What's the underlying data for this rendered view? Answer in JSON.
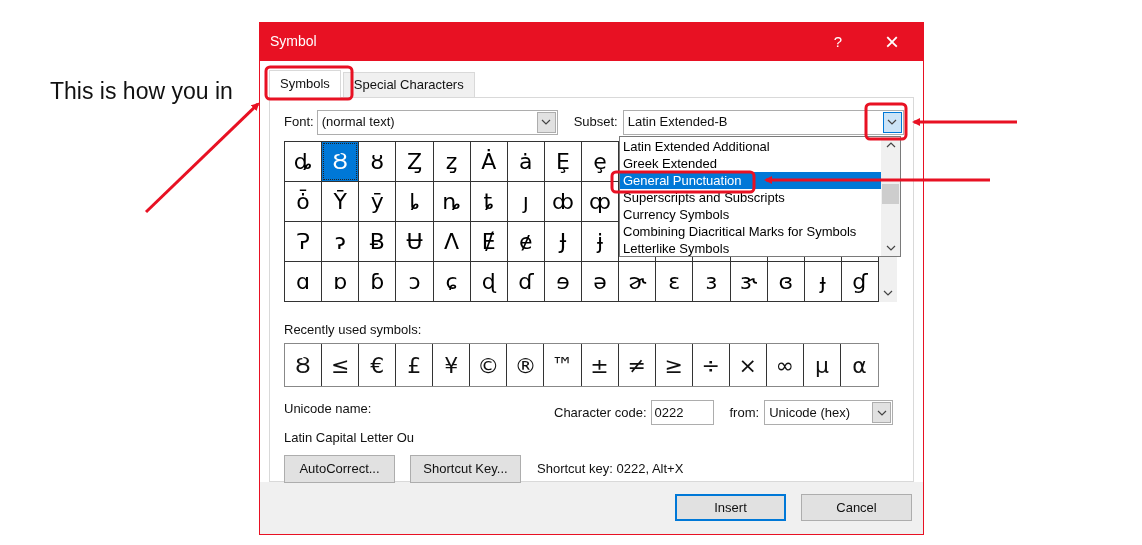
{
  "document": {
    "text": "This is how you in"
  },
  "window": {
    "title": "Symbol",
    "help": "?",
    "close": "×"
  },
  "tabs": [
    {
      "label": "Symbols",
      "selected": true
    },
    {
      "label": "Special Characters",
      "selected": false
    }
  ],
  "font": {
    "label": "Font:",
    "value": "(normal text)"
  },
  "subset": {
    "label": "Subset:",
    "value": "Latin Extended-B",
    "expanded": true,
    "options": [
      {
        "label": "Latin Extended Additional",
        "selected": false
      },
      {
        "label": "Greek Extended",
        "selected": false
      },
      {
        "label": "General Punctuation",
        "selected": true
      },
      {
        "label": "Superscripts and Subscripts",
        "selected": false
      },
      {
        "label": "Currency Symbols",
        "selected": false
      },
      {
        "label": "Combining Diacritical Marks for Symbols",
        "selected": false
      },
      {
        "label": "Letterlike Symbols",
        "selected": false
      }
    ]
  },
  "symbol_grid": [
    [
      {
        "symbol": "ȡ",
        "selected": false
      },
      {
        "symbol": "Ȣ",
        "selected": true
      },
      {
        "symbol": "ȣ",
        "selected": false
      },
      {
        "symbol": "Ȥ",
        "selected": false
      },
      {
        "symbol": "ȥ",
        "selected": false
      },
      {
        "symbol": "Ȧ",
        "selected": false
      },
      {
        "symbol": "ȧ",
        "selected": false
      },
      {
        "symbol": "Ȩ",
        "selected": false
      },
      {
        "symbol": "ȩ",
        "selected": false
      }
    ],
    [
      {
        "symbol": "ȱ",
        "selected": false
      },
      {
        "symbol": "Ȳ",
        "selected": false
      },
      {
        "symbol": "ȳ",
        "selected": false
      },
      {
        "symbol": "ȴ",
        "selected": false
      },
      {
        "symbol": "ȵ",
        "selected": false
      },
      {
        "symbol": "ȶ",
        "selected": false
      },
      {
        "symbol": "ȷ",
        "selected": false
      },
      {
        "symbol": "ȸ",
        "selected": false
      },
      {
        "symbol": "ȹ",
        "selected": false
      }
    ],
    [
      {
        "symbol": "Ɂ",
        "selected": false
      },
      {
        "symbol": "ɂ",
        "selected": false
      },
      {
        "symbol": "Ƀ",
        "selected": false
      },
      {
        "symbol": "Ʉ",
        "selected": false
      },
      {
        "symbol": "Ʌ",
        "selected": false
      },
      {
        "symbol": "Ɇ",
        "selected": false
      },
      {
        "symbol": "ɇ",
        "selected": false
      },
      {
        "symbol": "Ɉ",
        "selected": false
      },
      {
        "symbol": "ɉ",
        "selected": false
      }
    ],
    [
      {
        "symbol": "ɑ",
        "selected": false
      },
      {
        "symbol": "ɒ",
        "selected": false
      },
      {
        "symbol": "ɓ",
        "selected": false
      },
      {
        "symbol": "ɔ",
        "selected": false
      },
      {
        "symbol": "ɕ",
        "selected": false
      },
      {
        "symbol": "ɖ",
        "selected": false
      },
      {
        "symbol": "ɗ",
        "selected": false
      },
      {
        "symbol": "ɘ",
        "selected": false
      },
      {
        "symbol": "ə",
        "selected": false
      },
      {
        "symbol": "ɚ",
        "selected": false
      },
      {
        "symbol": "ɛ",
        "selected": false
      },
      {
        "symbol": "ɜ",
        "selected": false
      },
      {
        "symbol": "ɝ",
        "selected": false
      },
      {
        "symbol": "ɞ",
        "selected": false
      },
      {
        "symbol": "ɟ",
        "selected": false
      },
      {
        "symbol": "ɠ",
        "selected": false
      }
    ]
  ],
  "recent": {
    "label": "Recently used symbols:",
    "symbols": [
      "Ȣ",
      "≤",
      "€",
      "£",
      "¥",
      "©",
      "®",
      "™",
      "±",
      "≠",
      "≥",
      "÷",
      "×",
      "∞",
      "µ",
      "α"
    ]
  },
  "unicode_name": {
    "label": "Unicode name:",
    "value": "Latin Capital Letter Ou"
  },
  "character_code": {
    "label": "Character code:",
    "value": "0222"
  },
  "from": {
    "label": "from:",
    "value": "Unicode (hex)"
  },
  "autocorrect_button": "AutoCorrect...",
  "shortcut_key_button": "Shortcut Key...",
  "shortcut_key": "Shortcut key: 0222, Alt+X",
  "buttons": [
    {
      "label": "Insert",
      "default": true
    },
    {
      "label": "Cancel",
      "default": false
    }
  ]
}
